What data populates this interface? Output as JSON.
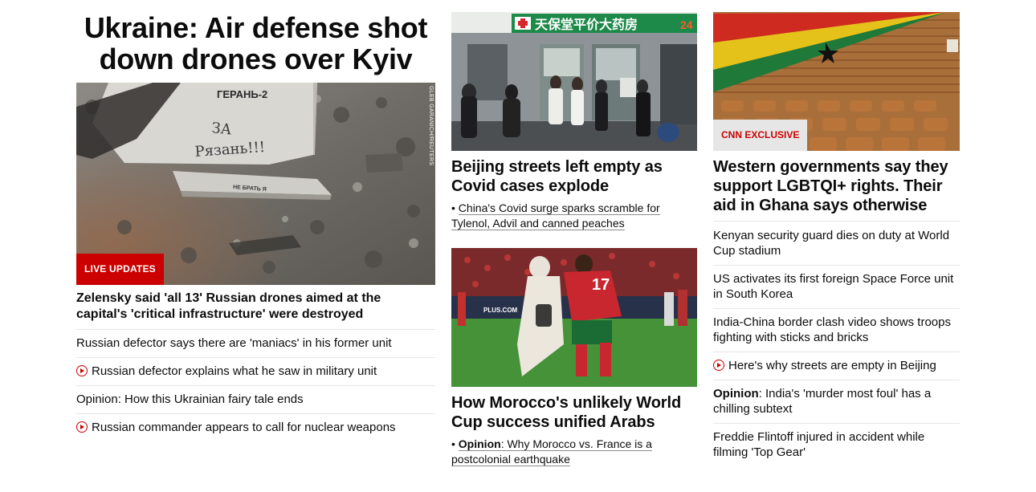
{
  "lead": {
    "title": "Ukraine: Air defense shot down drones over Kyiv",
    "image": {
      "drone_text": "ГЕРАНЬ-2",
      "handwriting_1": "ЗА",
      "handwriting_2": "Рязань!!!",
      "fin_text": "НЕ БРАТЬ Я",
      "credit": "GLEB GARANICH/REUTERS"
    },
    "badge": "LIVE UPDATES",
    "headline": "Zelensky said 'all 13' Russian drones aimed at the capital's 'critical infrastructure' were destroyed",
    "stories": [
      {
        "text": "Russian defector says there are 'maniacs' in his former unit",
        "video": false
      },
      {
        "text": "Russian defector explains what he saw in military unit",
        "video": true
      },
      {
        "text": "Opinion: How this Ukrainian fairy tale ends",
        "video": false
      },
      {
        "text": "Russian commander appears to call for nuclear weapons",
        "video": true
      }
    ]
  },
  "middle": {
    "story1": {
      "sign": "天保堂平价大药房",
      "sign_num": "24",
      "headline": "Beijing streets left empty as Covid cases explode",
      "sub_bullet": "•",
      "sub": "China's Covid surge sparks scramble for Tylenol, Advil and canned peaches"
    },
    "story2": {
      "jersey": "17",
      "board": "PLUS.COM",
      "headline": "How Morocco's unlikely World Cup success unified Arabs",
      "sub_bullet": "•",
      "sub_label": "Opinion",
      "sub": "Why Morocco vs. France is a postcolonial earthquake"
    }
  },
  "right": {
    "badge": "CNN EXCLUSIVE",
    "headline": "Western governments say they support LGBTQI+ rights. Their aid in Ghana says otherwise",
    "stories": [
      {
        "text": "Kenyan security guard dies on duty at World Cup stadium"
      },
      {
        "text": "US activates its first foreign Space Force unit in South Korea"
      },
      {
        "text": "India-China border clash video shows troops fighting with sticks and bricks"
      },
      {
        "text": "Here's why streets are empty in Beijing"
      },
      {
        "label": "Opinion",
        "text": ": India's 'murder most foul' has a chilling subtext"
      },
      {
        "text": "Freddie Flintoff injured in accident while filming 'Top Gear'"
      }
    ]
  },
  "colors": {
    "brand_red": "#cc0000",
    "divider": "#e6e6e6",
    "text": "#0c0c0c"
  }
}
